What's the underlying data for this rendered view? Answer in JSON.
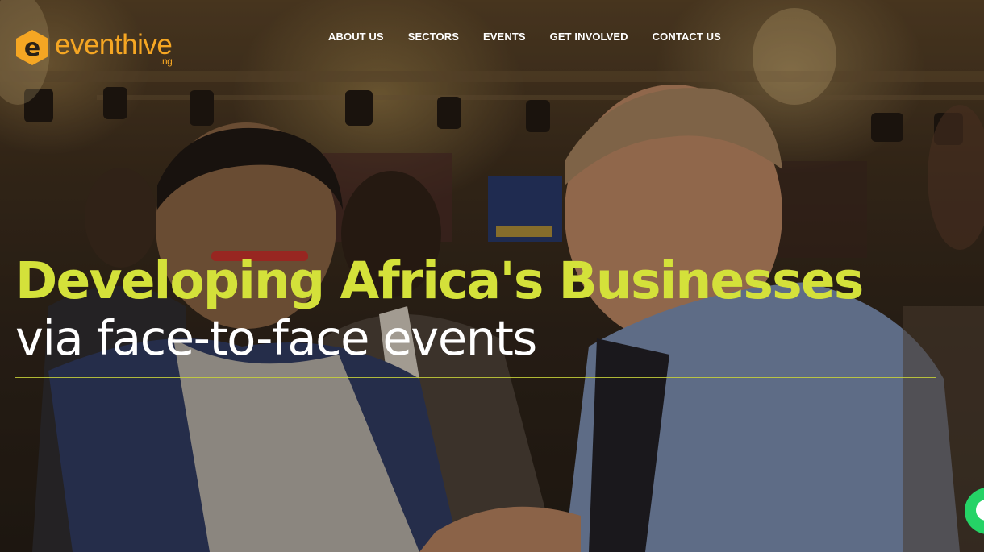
{
  "brand": {
    "name": "eventhive",
    "suffix": ".ng",
    "mark_letter": "e",
    "color": "#f5a623"
  },
  "nav": {
    "items": [
      {
        "label": "ABOUT US"
      },
      {
        "label": "SECTORS"
      },
      {
        "label": "EVENTS"
      },
      {
        "label": "GET INVOLVED"
      },
      {
        "label": "CONTACT US"
      }
    ]
  },
  "hero": {
    "headline": "Developing Africa's Businesses",
    "subline": "via face-to-face events",
    "headline_color": "#d4e13a",
    "background_image": "conference networking photo"
  },
  "chat_widget": {
    "icon": "whatsapp-chat-icon",
    "color": "#25d366"
  }
}
